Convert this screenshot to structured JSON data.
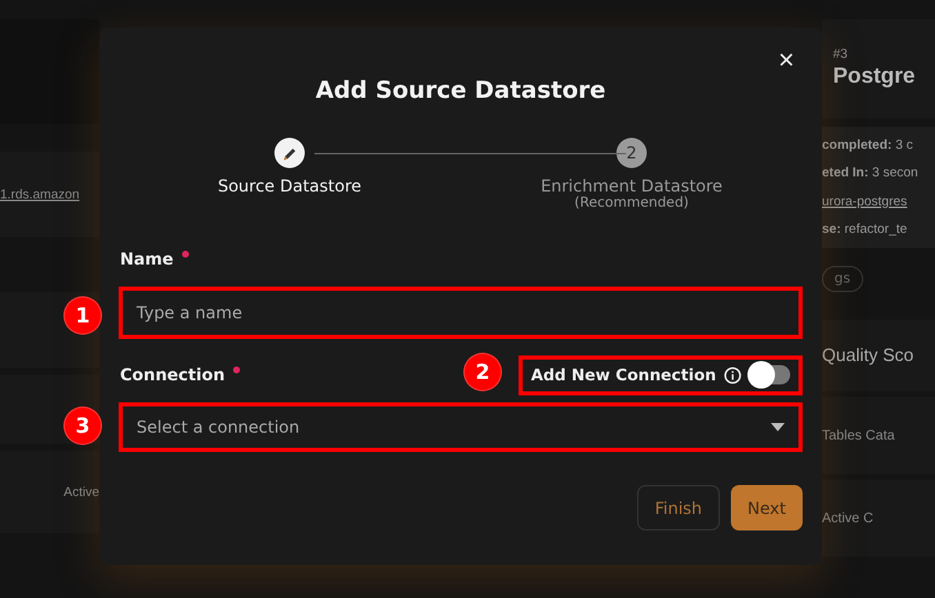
{
  "background": {
    "left": {
      "link": "1.rds.amazon",
      "label": "Active"
    },
    "right": {
      "number": "#3",
      "title": "Postgre",
      "details": [
        {
          "key": "completed:",
          "value": " 3 c",
          "link": false
        },
        {
          "key": "eted In:",
          "value": " 3 secon",
          "link": false
        },
        {
          "value": "urora-postgres",
          "link": true
        },
        {
          "key": "se:",
          "value": " refactor_te",
          "link": false
        }
      ],
      "tag": "gs",
      "metrics": [
        "Quality Sco",
        "Tables Cata",
        "Active C"
      ]
    }
  },
  "dialog": {
    "title": "Add Source Datastore",
    "close": "×",
    "steps": [
      {
        "label": "Source Datastore",
        "active": true
      },
      {
        "label": "Enrichment Datastore",
        "note": "(Recommended)",
        "active": false,
        "number": "2"
      }
    ],
    "fields": [
      {
        "label": "Name",
        "required": true,
        "kind": "text",
        "placeholder": "Type a name",
        "annotation": "1"
      },
      {
        "label": "Connection",
        "required": true,
        "kind": "select",
        "placeholder": "Select a connection",
        "annotation": "3",
        "toggle": {
          "label": "Add New Connection",
          "on": false,
          "annotation": "2"
        }
      }
    ],
    "buttons": [
      {
        "label": "Finish",
        "kind": "secondary"
      },
      {
        "label": "Next",
        "kind": "primary"
      }
    ]
  }
}
